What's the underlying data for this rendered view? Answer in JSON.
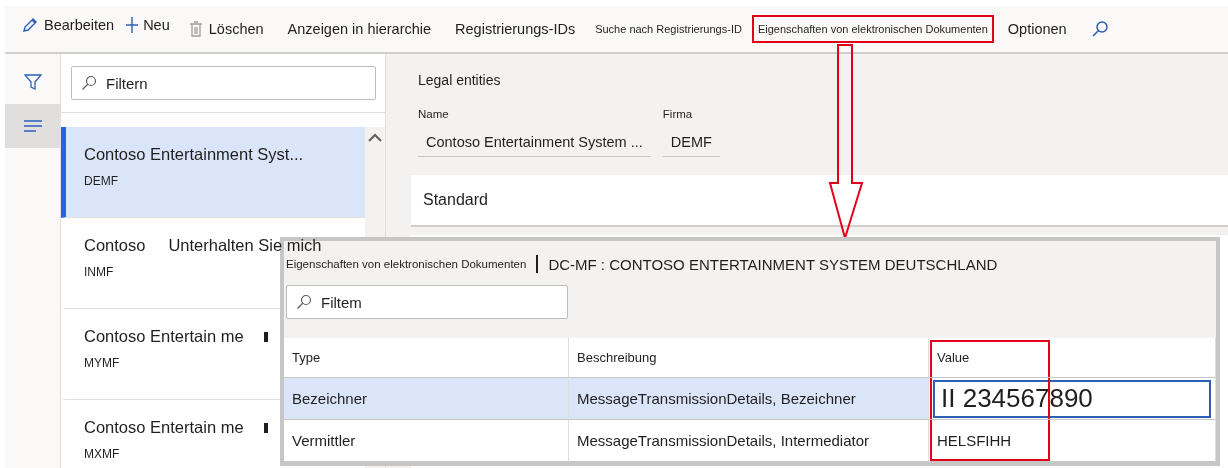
{
  "toolbar": {
    "items": [
      {
        "kind": "edit",
        "label": "Bearbeiten",
        "highlighted": false
      },
      {
        "kind": "new",
        "label": "Neu",
        "highlighted": false
      },
      {
        "kind": "delete",
        "label": "Löschen",
        "highlighted": false
      },
      {
        "kind": "text",
        "label": "Anzeigen in hierarchie",
        "highlighted": false
      },
      {
        "kind": "text",
        "label": "Registrierungs-IDs",
        "highlighted": false
      },
      {
        "kind": "small",
        "label": "Suche nach Registrierungs-ID",
        "highlighted": false
      },
      {
        "kind": "small",
        "label": "Eigenschaften von elektronischen Dokumenten",
        "highlighted": true
      },
      {
        "kind": "text",
        "label": "Optionen",
        "highlighted": false
      },
      {
        "kind": "search",
        "highlighted": false
      }
    ]
  },
  "rail": {
    "items": [
      {
        "kind": "filter",
        "selected": false
      },
      {
        "kind": "list",
        "selected": true
      }
    ]
  },
  "list": {
    "filter": {
      "placeholder": "Filtern"
    },
    "items": [
      {
        "name": "Contoso Entertainment Syst...",
        "code": "DEMF",
        "selected": true,
        "marker": false
      },
      {
        "name": "Contoso     Unterhalten Sie mich",
        "code": "INMF",
        "selected": false,
        "marker": false
      },
      {
        "name": "Contoso Entertain me",
        "code": "MYMF",
        "selected": false,
        "marker": true
      },
      {
        "name": "Contoso Entertain me",
        "code": "MXMF",
        "selected": false,
        "marker": true
      }
    ]
  },
  "detail": {
    "title": "Legal entities",
    "fields": [
      {
        "label": "Name",
        "value": "Contoso Entertainment System ..."
      },
      {
        "label": "Firma",
        "value": "DEMF"
      }
    ],
    "sections": [
      {
        "title": "Standard"
      }
    ]
  },
  "dialog": {
    "title": "Eigenschaften von elektronischen Dokumenten",
    "record": "DC-MF : CONTOSO ENTERTAINMENT SYSTEM DEUTSCHLAND",
    "filter": {
      "placeholder": "Filtem"
    },
    "columns": [
      {
        "label": "Type",
        "highlighted": false
      },
      {
        "label": "Beschreibung",
        "highlighted": false
      },
      {
        "label": "Value",
        "highlighted": true
      }
    ],
    "rows": [
      {
        "type": "Bezeichner",
        "description": "MessageTransmissionDetails, Bezeichner",
        "value": "II 234567890",
        "selected": true,
        "editing": true
      },
      {
        "type": "Vermittler",
        "description": "MessageTransmissionDetails, Intermediator",
        "value": "HELSFIHH",
        "selected": false,
        "editing": false
      }
    ]
  }
}
